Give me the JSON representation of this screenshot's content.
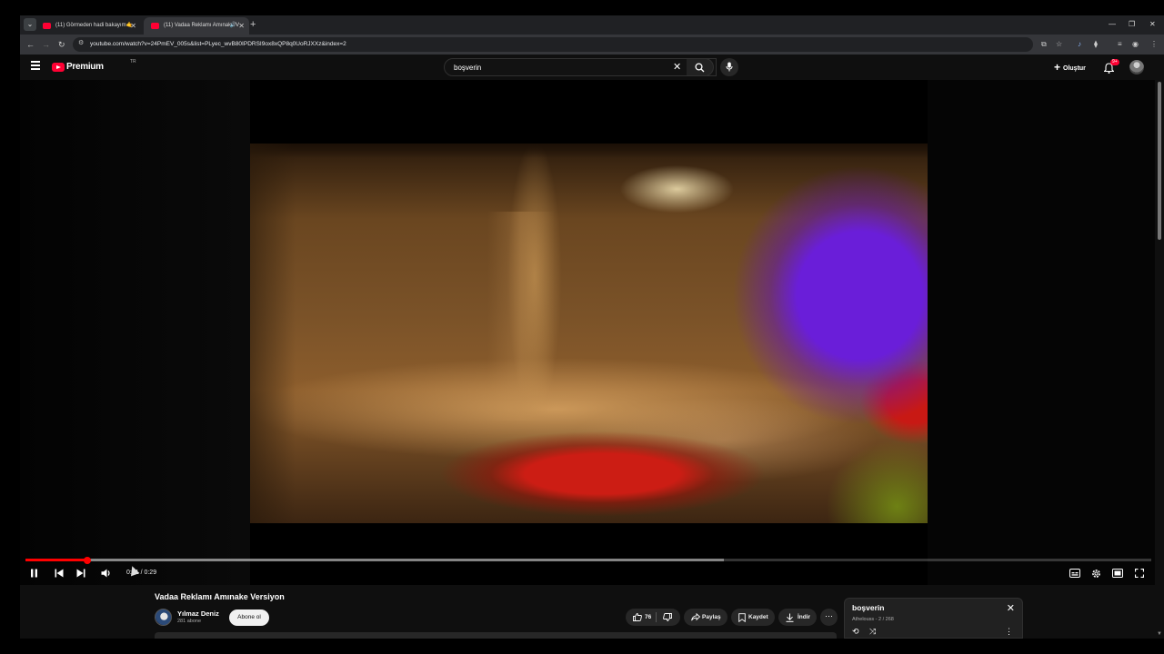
{
  "browser": {
    "tabs": [
      {
        "label": "(11) Görmeden hadi bakayım🤙"
      },
      {
        "label": "(11) Vadaa Reklamı Amınake V"
      }
    ],
    "url": "youtube.com/watch?v=24PmEV_005s&list=PLyec_wvB80IPDRSI9ox8xQP8q0UoRJXXz&index=2"
  },
  "masthead": {
    "logo_text": "Premium",
    "country_code": "TR",
    "search_value": "boşverin",
    "create_label": "Oluştur",
    "notification_count": "9+"
  },
  "player": {
    "time_current": "0:01",
    "time_total": "0:29",
    "time_display": "0:01 / 0:29",
    "progress_played_fraction": 0.055,
    "progress_buffered_fraction": 0.62
  },
  "video_info": {
    "title": "Vadaa Reklamı Amınake Versiyon",
    "channel_name": "Yılmaz Deniz",
    "subscribers": "281 abone",
    "subscribe_label": "Abone ol",
    "like_count": "76",
    "share_label": "Paylaş",
    "save_label": "Kaydet",
    "download_label": "İndir"
  },
  "playlist": {
    "title": "boşverin",
    "meta": "Athelouss - 2 / 268"
  },
  "colors": {
    "accent": "#ff0000",
    "background": "#0f0f0f",
    "surface": "#272727"
  }
}
